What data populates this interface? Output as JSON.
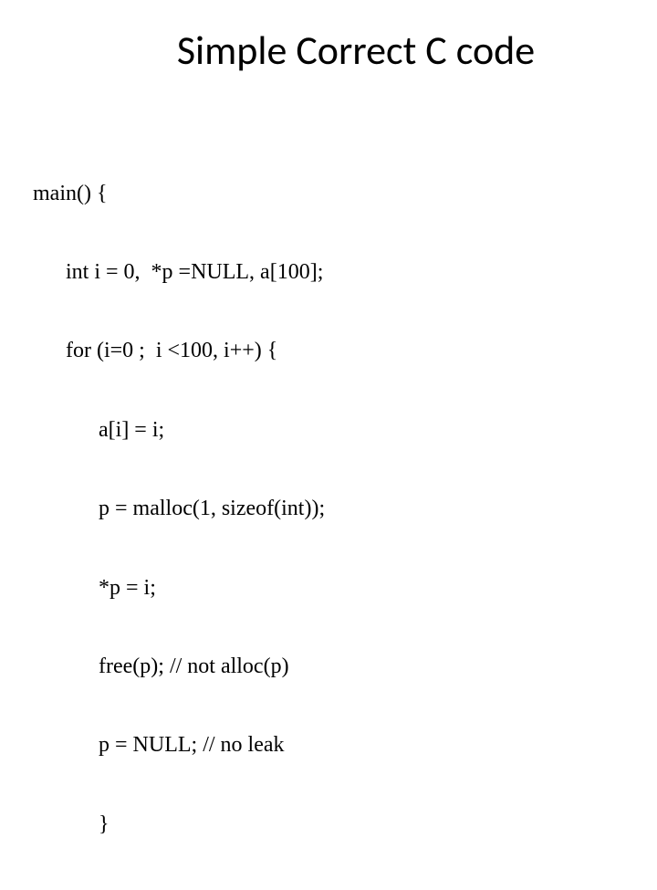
{
  "title": "Simple Correct C code",
  "code": {
    "l1": "main() {",
    "l2": "int i = 0,  *p =NULL, a[100];",
    "l3": "for (i=0 ;  i <100, i++) {",
    "l4": "a[i] = i;",
    "l5": "p = malloc(1, sizeof(int));",
    "l6": "*p = i;",
    "l7": "free(p); // not alloc(p)",
    "l8": "p = NULL; // no leak",
    "l9": "}"
  }
}
